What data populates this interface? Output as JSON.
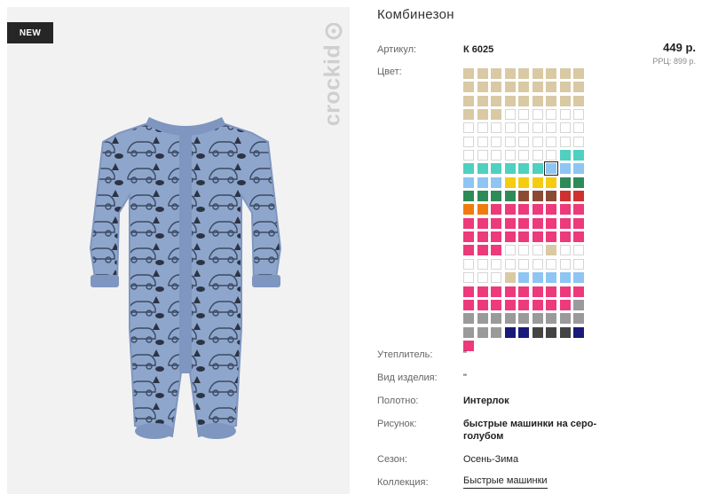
{
  "badge": {
    "new": "NEW"
  },
  "brand": {
    "logo_text": "crockid"
  },
  "product": {
    "title": "Комбинезон",
    "article_label": "Артикул:",
    "article_value": "К 6025",
    "price": "449 р.",
    "rrp": "РРЦ: 899 р.",
    "color_label": "Цвет:"
  },
  "specs": {
    "insulation_label": "Утеплитель:",
    "insulation_value": "\"",
    "type_label": "Вид изделия:",
    "type_value": "\"",
    "fabric_label": "Полотно:",
    "fabric_value": "Интерлок",
    "print_label": "Рисунок:",
    "print_value_line1": "быстрые машинки на серо-",
    "print_value_line2": "голубом",
    "season_label": "Сезон:",
    "season_value": "Осень-Зима",
    "collection_label": "Коллекция:",
    "collection_value": "Быстрые машинки"
  },
  "colors": {
    "beige": "#d9c9a4",
    "white": "#ffffff",
    "mint": "#4fd0c0",
    "sky": "#8ec5f2",
    "yellow": "#f4cc12",
    "green": "#2e8b57",
    "brown": "#8b4a32",
    "red": "#d03030",
    "orange": "#f07c10",
    "pink": "#ec3a7a",
    "gray": "#9a9a9a",
    "navy": "#1a1a7a",
    "dark": "#444444",
    "garment": "#8fa6cc",
    "garment_trim": "#7f96c0"
  },
  "swatches": [
    "beige",
    "beige",
    "beige",
    "beige",
    "beige",
    "beige",
    "beige",
    "beige",
    "beige",
    "beige",
    "beige",
    "beige",
    "beige",
    "beige",
    "beige",
    "beige",
    "beige",
    "beige",
    "beige",
    "beige",
    "beige",
    "beige",
    "beige",
    "beige",
    "beige",
    "beige",
    "beige",
    "beige",
    "beige",
    "beige",
    "white",
    "white",
    "white",
    "white",
    "white",
    "white",
    "white",
    "white",
    "white",
    "white",
    "white",
    "white",
    "white",
    "white",
    "white",
    "white",
    "white",
    "white",
    "white",
    "white",
    "white",
    "white",
    "white",
    "white",
    "white",
    "white",
    "white",
    "white",
    "white",
    "white",
    "white",
    "mint",
    "mint",
    "mint",
    "mint",
    "mint",
    "mint",
    "mint",
    "mint",
    "sky",
    "sky",
    "sky",
    "sky",
    "sky",
    "sky",
    "yellow",
    "yellow",
    "yellow",
    "yellow",
    "green",
    "green",
    "green",
    "green",
    "green",
    "green",
    "brown",
    "brown",
    "brown",
    "red",
    "red",
    "orange",
    "orange",
    "pink",
    "pink",
    "pink",
    "pink",
    "pink",
    "pink",
    "pink",
    "pink",
    "pink",
    "pink",
    "pink",
    "pink",
    "pink",
    "pink",
    "pink",
    "pink",
    "pink",
    "pink",
    "pink",
    "pink",
    "pink",
    "pink",
    "pink",
    "pink",
    "pink",
    "pink",
    "pink",
    "pink",
    "white",
    "white",
    "white",
    "beige",
    "white",
    "white",
    "white",
    "white",
    "white",
    "white",
    "white",
    "white",
    "white",
    "white",
    "white",
    "white",
    "white",
    "white",
    "beige",
    "sky",
    "sky",
    "sky",
    "sky",
    "sky",
    "pink",
    "pink",
    "pink",
    "pink",
    "pink",
    "pink",
    "pink",
    "pink",
    "pink",
    "pink",
    "pink",
    "pink",
    "pink",
    "pink",
    "pink",
    "pink",
    "pink",
    "gray",
    "gray",
    "gray",
    "gray",
    "gray",
    "gray",
    "gray",
    "gray",
    "gray",
    "gray",
    "gray",
    "gray",
    "gray",
    "navy",
    "navy",
    "dark",
    "dark",
    "dark",
    "navy",
    "pink"
  ],
  "selected_swatch_index": 69
}
